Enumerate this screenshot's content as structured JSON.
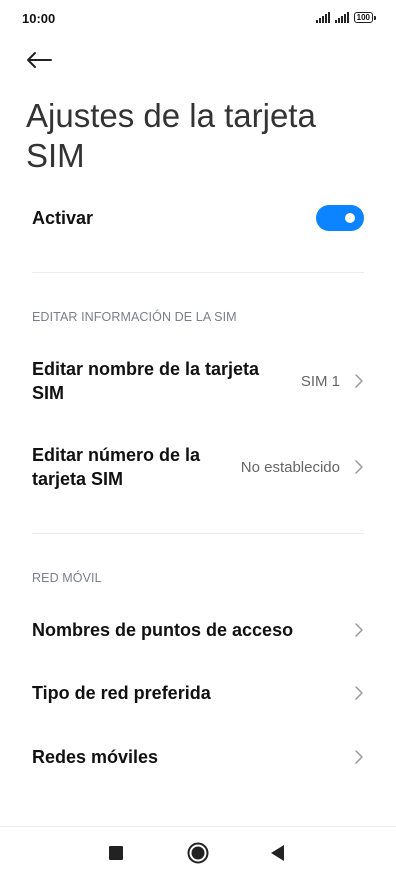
{
  "status_bar": {
    "time": "10:00",
    "battery": "100",
    "icons": [
      "signal-icon",
      "signal-icon",
      "battery-icon"
    ]
  },
  "header": {
    "back_icon": "arrow-left-icon",
    "title": "Ajustes de la tarjeta SIM"
  },
  "activate": {
    "label": "Activar",
    "enabled": true,
    "toggle_color": "#0d84ff"
  },
  "sim_section": {
    "header": "EDITAR INFORMACIÓN DE LA SIM",
    "items": [
      {
        "label": "Editar nombre de la tarjeta SIM",
        "value": "SIM 1"
      },
      {
        "label": "Editar número de la tarjeta SIM",
        "value": "No establecido"
      }
    ]
  },
  "network_section": {
    "header": "RED MÓVIL",
    "items": [
      {
        "label": "Nombres de puntos de acceso"
      },
      {
        "label": "Tipo de red preferida"
      },
      {
        "label": "Redes móviles"
      }
    ]
  },
  "nav_bar": {
    "icons": [
      "recents-square-icon",
      "home-circle-icon",
      "back-triangle-icon"
    ]
  }
}
